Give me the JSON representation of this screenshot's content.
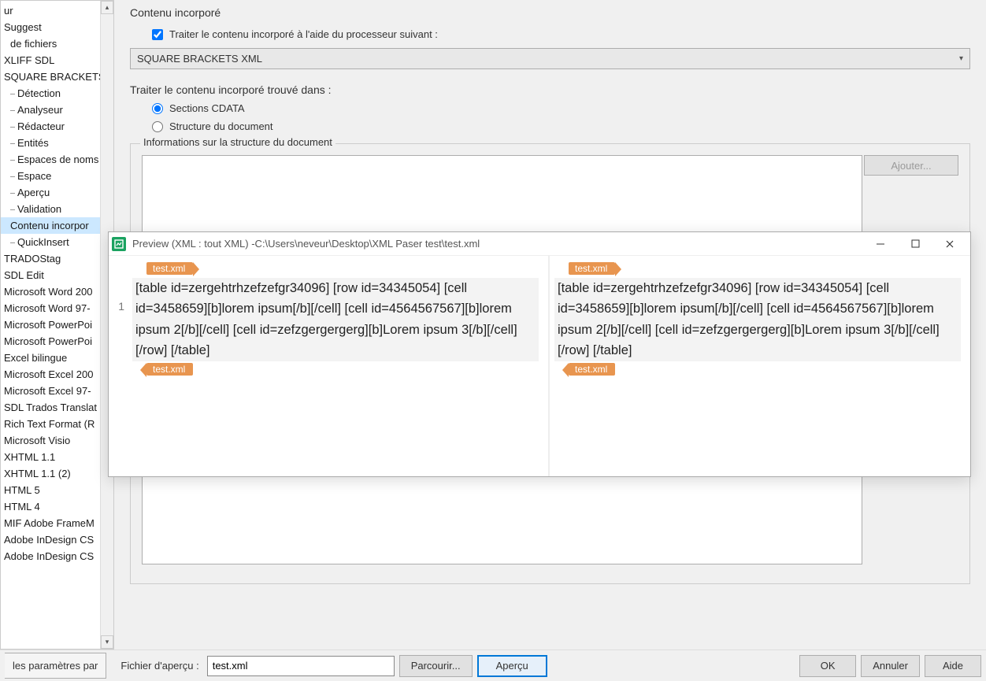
{
  "sidebar": {
    "items": [
      {
        "label": "ur",
        "indent": 0,
        "marker": false
      },
      {
        "label": "Suggest",
        "indent": 0,
        "marker": false
      },
      {
        "label": "de fichiers",
        "indent": 1,
        "marker": false
      },
      {
        "label": "XLIFF SDL",
        "indent": 0,
        "marker": false
      },
      {
        "label": "SQUARE BRACKETS",
        "indent": 0,
        "marker": false
      },
      {
        "label": "Détection",
        "indent": 1,
        "marker": true
      },
      {
        "label": "Analyseur",
        "indent": 1,
        "marker": true
      },
      {
        "label": "Rédacteur",
        "indent": 1,
        "marker": true
      },
      {
        "label": "Entités",
        "indent": 1,
        "marker": true
      },
      {
        "label": "Espaces de noms",
        "indent": 1,
        "marker": true
      },
      {
        "label": "Espace",
        "indent": 1,
        "marker": true
      },
      {
        "label": "Aperçu",
        "indent": 1,
        "marker": true
      },
      {
        "label": "Validation",
        "indent": 1,
        "marker": true
      },
      {
        "label": "Contenu incorpor",
        "indent": 1,
        "marker": false,
        "selected": true
      },
      {
        "label": "QuickInsert",
        "indent": 1,
        "marker": true
      },
      {
        "label": "TRADOStag",
        "indent": 0,
        "marker": false
      },
      {
        "label": "SDL Edit",
        "indent": 0,
        "marker": false
      },
      {
        "label": "Microsoft Word 200",
        "indent": 0,
        "marker": false
      },
      {
        "label": "Microsoft Word 97-",
        "indent": 0,
        "marker": false
      },
      {
        "label": "Microsoft PowerPoi",
        "indent": 0,
        "marker": false
      },
      {
        "label": "Microsoft PowerPoi",
        "indent": 0,
        "marker": false
      },
      {
        "label": "Excel bilingue",
        "indent": 0,
        "marker": false
      },
      {
        "label": "Microsoft Excel 200",
        "indent": 0,
        "marker": false
      },
      {
        "label": "Microsoft Excel 97-",
        "indent": 0,
        "marker": false
      },
      {
        "label": "SDL Trados Translat",
        "indent": 0,
        "marker": false
      },
      {
        "label": "Rich Text Format (R",
        "indent": 0,
        "marker": false
      },
      {
        "label": "Microsoft Visio",
        "indent": 0,
        "marker": false
      },
      {
        "label": "XHTML 1.1",
        "indent": 0,
        "marker": false
      },
      {
        "label": "XHTML 1.1 (2)",
        "indent": 0,
        "marker": false
      },
      {
        "label": "HTML 5",
        "indent": 0,
        "marker": false
      },
      {
        "label": "HTML 4",
        "indent": 0,
        "marker": false
      },
      {
        "label": "MIF Adobe FrameM",
        "indent": 0,
        "marker": false
      },
      {
        "label": "Adobe InDesign CS",
        "indent": 0,
        "marker": false
      },
      {
        "label": "Adobe InDesign CS",
        "indent": 0,
        "marker": false
      }
    ]
  },
  "content": {
    "heading": "Contenu incorporé",
    "checkbox_label": "Traiter le contenu incorporé à l'aide du processeur suivant :",
    "dropdown_value": "SQUARE BRACKETS XML",
    "found_in_label": "Traiter le contenu incorporé trouvé dans :",
    "radio_cdata": "Sections CDATA",
    "radio_struct": "Structure du document",
    "fieldset_legend": "Informations sur la structure du document",
    "add_button": "Ajouter..."
  },
  "preview": {
    "title": "Preview (XML : tout XML) -C:\\Users\\neveur\\Desktop\\XML Paser test\\test.xml",
    "row_number": "1",
    "tag_label": "test.xml",
    "body_text": "[table id=zergehtrhzefzefgr34096] [row id=34345054] [cell id=3458659][b]lorem ipsum[/b][/cell] [cell id=4564567567][b]lorem ipsum 2[/b][/cell] [cell id=zefzgergergerg][b]Lorem ipsum 3[/b][/cell] [/row] [/table]"
  },
  "bottom": {
    "reset_label": "les paramètres par",
    "file_label": "Fichier d'aperçu :",
    "file_value": "test.xml",
    "browse": "Parcourir...",
    "preview": "Aperçu",
    "ok": "OK",
    "cancel": "Annuler",
    "help": "Aide"
  }
}
